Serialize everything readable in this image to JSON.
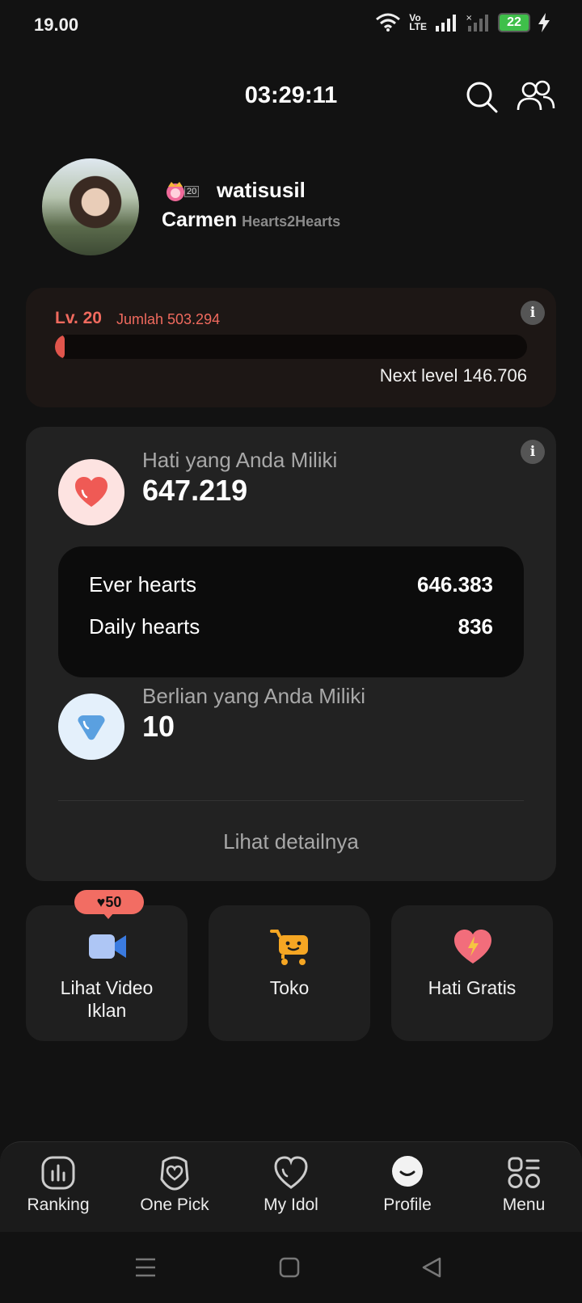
{
  "status_bar": {
    "time": "19.00",
    "volte_top": "Vo",
    "volte_bottom": "LTE",
    "battery": "22"
  },
  "header": {
    "timer": "03:29:11",
    "icons": [
      "search-icon",
      "friends-icon"
    ]
  },
  "profile": {
    "badge_level": "20",
    "username": "watisusil",
    "idol_name": "Carmen",
    "group_name": "Hearts2Hearts"
  },
  "level_card": {
    "level": "Lv. 20",
    "total": "Jumlah 503.294",
    "progress_percent": 2,
    "next_level": "Next level 146.706",
    "info": "i"
  },
  "hearts_card": {
    "info": "i",
    "hearts_label": "Hati yang Anda Miliki",
    "hearts_value": "647.219",
    "ever_label": "Ever hearts",
    "ever_value": "646.383",
    "daily_label": "Daily hearts",
    "daily_value": "836",
    "diamond_label": "Berlian yang Anda Miliki",
    "diamond_value": "10",
    "detail_link": "Lihat detailnya"
  },
  "tiles": {
    "video_badge": "♥50",
    "video_label_line1": "Lihat Video",
    "video_label_line2": "Iklan",
    "shop_label": "Toko",
    "free_label": "Hati Gratis"
  },
  "bottom_nav": {
    "ranking": "Ranking",
    "one_pick": "One Pick",
    "my_idol": "My Idol",
    "profile": "Profile",
    "menu": "Menu"
  },
  "colors": {
    "accent": "#f06a5e",
    "background": "#121212",
    "card": "#222222",
    "diamond": "#5aa0e0",
    "shop": "#f5a623"
  }
}
